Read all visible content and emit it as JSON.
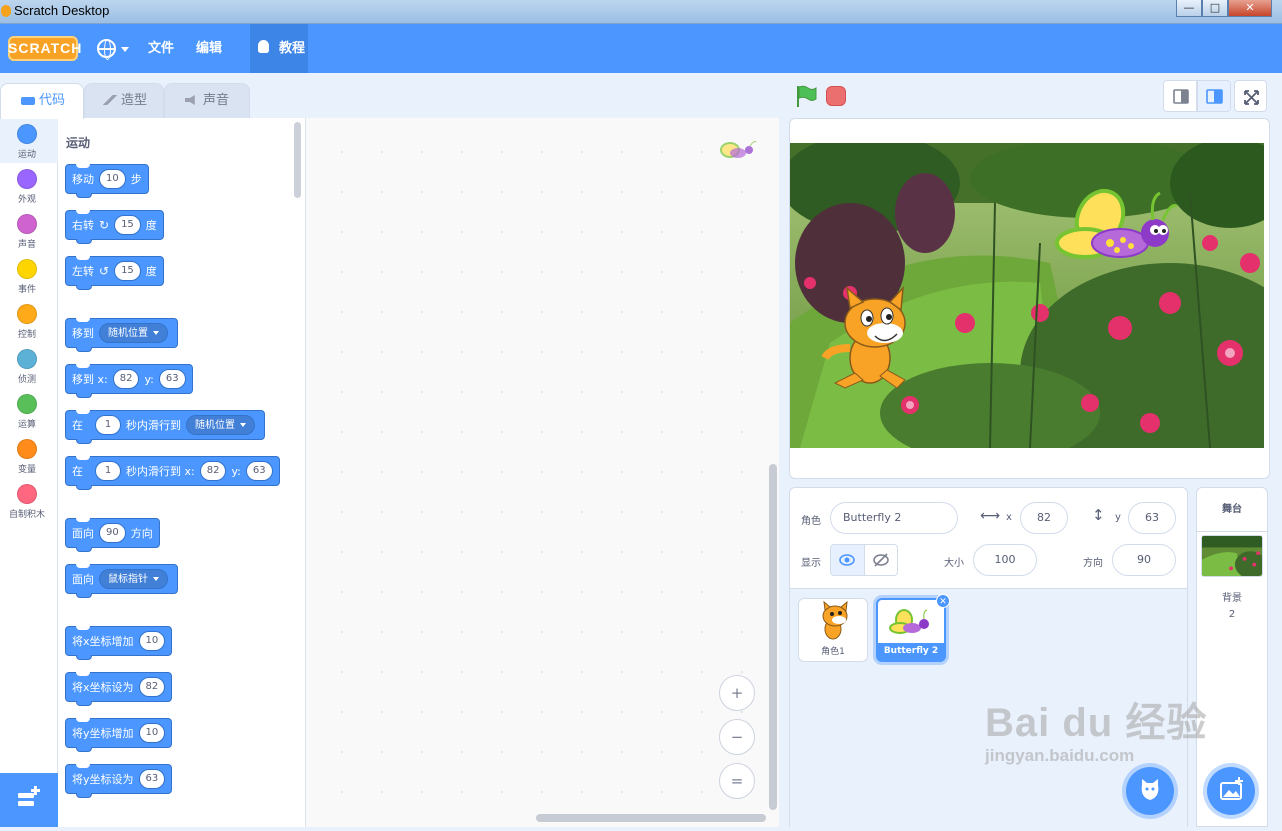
{
  "window": {
    "title": "Scratch Desktop",
    "min": "—",
    "max": "□",
    "close": "✕"
  },
  "menubar": {
    "logo": "SCRATCH",
    "file": "文件",
    "edit": "编辑",
    "tutorials": "教程"
  },
  "tabs": [
    {
      "label": "代码"
    },
    {
      "label": "造型"
    },
    {
      "label": "声音"
    }
  ],
  "categories": [
    {
      "label": "运动",
      "color": "#4c97ff"
    },
    {
      "label": "外观",
      "color": "#9966ff"
    },
    {
      "label": "声音",
      "color": "#cf63cf"
    },
    {
      "label": "事件",
      "color": "#ffd500"
    },
    {
      "label": "控制",
      "color": "#ffab19"
    },
    {
      "label": "侦测",
      "color": "#5cb1d6"
    },
    {
      "label": "运算",
      "color": "#59c059"
    },
    {
      "label": "变量",
      "color": "#ff8c1a"
    },
    {
      "label": "自制积木",
      "color": "#ff6680"
    }
  ],
  "palette": {
    "section_title": "运动",
    "move": {
      "a": "移动",
      "v": "10",
      "b": "步"
    },
    "turn_right": {
      "a": "右转",
      "v": "15",
      "b": "度"
    },
    "turn_left": {
      "a": "左转",
      "v": "15",
      "b": "度"
    },
    "goto": {
      "a": "移到",
      "opt": "随机位置"
    },
    "goto_xy": {
      "a": "移到 x:",
      "x": "82",
      "ylabel": "y:",
      "y": "63"
    },
    "glide": {
      "a": "在",
      "v": "1",
      "b": "秒内滑行到",
      "opt": "随机位置"
    },
    "glide_xy": {
      "a": "在",
      "v": "1",
      "b": "秒内滑行到 x:",
      "x": "82",
      "ylabel": "y:",
      "y": "63"
    },
    "point_dir": {
      "a": "面向",
      "v": "90",
      "b": "方向"
    },
    "point_to": {
      "a": "面向",
      "opt": "鼠标指针"
    },
    "change_x": {
      "a": "将x坐标增加",
      "v": "10"
    },
    "set_x": {
      "a": "将x坐标设为",
      "v": "82"
    },
    "change_y": {
      "a": "将y坐标增加",
      "v": "10"
    },
    "set_y": {
      "a": "将y坐标设为",
      "v": "63"
    }
  },
  "zoom": {
    "in": "+",
    "out": "−",
    "reset": "="
  },
  "sprite_info": {
    "sprite_label": "角色",
    "sprite_name": "Butterfly 2",
    "x_label": "x",
    "x": "82",
    "y_label": "y",
    "y": "63",
    "show_label": "显示",
    "size_label": "大小",
    "size": "100",
    "direction_label": "方向",
    "direction": "90"
  },
  "sprites": [
    {
      "name": "角色1"
    },
    {
      "name": "Butterfly 2"
    }
  ],
  "stage_panel": {
    "title": "舞台",
    "backdrops_label": "背景",
    "backdrops_count": "2"
  },
  "watermark": {
    "main": "Bai du 经验",
    "sub": "jingyan.baidu.com"
  }
}
